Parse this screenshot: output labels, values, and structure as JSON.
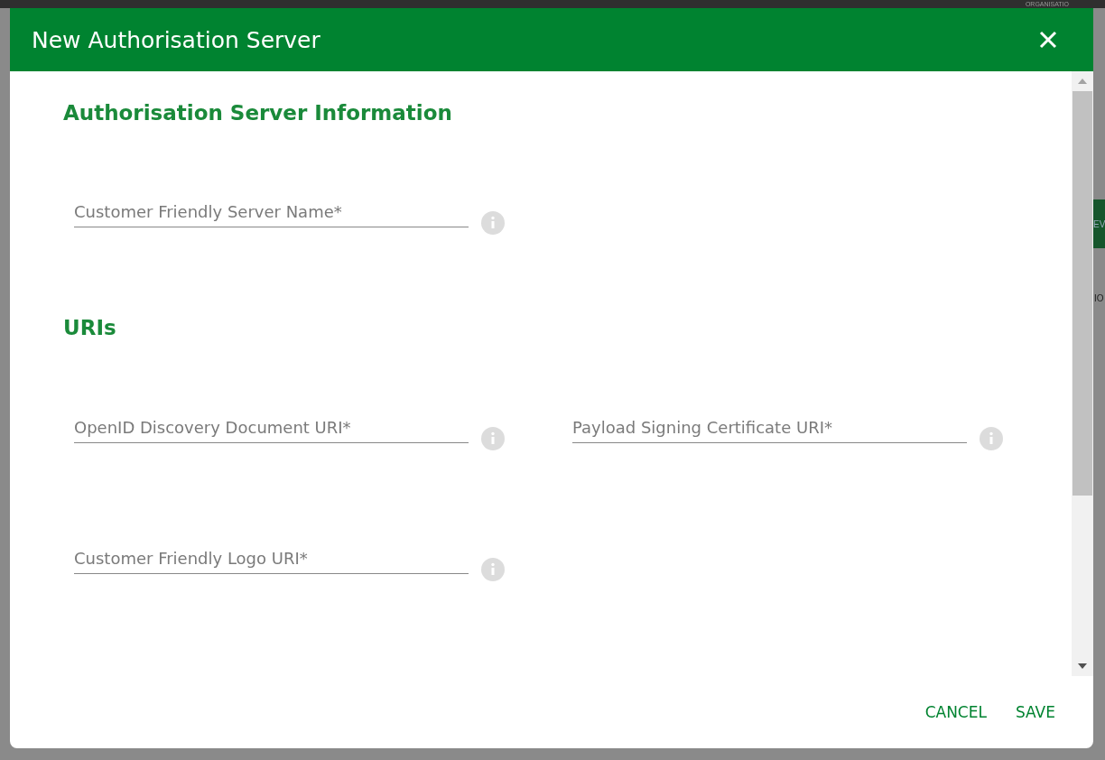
{
  "backdrop": {
    "top_bar_text": "ORGANISATIO",
    "button_text": "EV",
    "row_text": "IO"
  },
  "dialog": {
    "title": "New Authorisation Server",
    "sections": [
      {
        "heading": "Authorisation Server Information",
        "fields": [
          {
            "placeholder": "Customer Friendly Server Name*"
          }
        ]
      },
      {
        "heading": "URIs",
        "fields": [
          {
            "placeholder": "OpenID Discovery Document URI*"
          },
          {
            "placeholder": "Payload Signing Certificate URI*"
          },
          {
            "placeholder": "Customer Friendly Logo URI*"
          }
        ]
      }
    ],
    "buttons": [
      "CANCEL",
      "SAVE"
    ]
  }
}
